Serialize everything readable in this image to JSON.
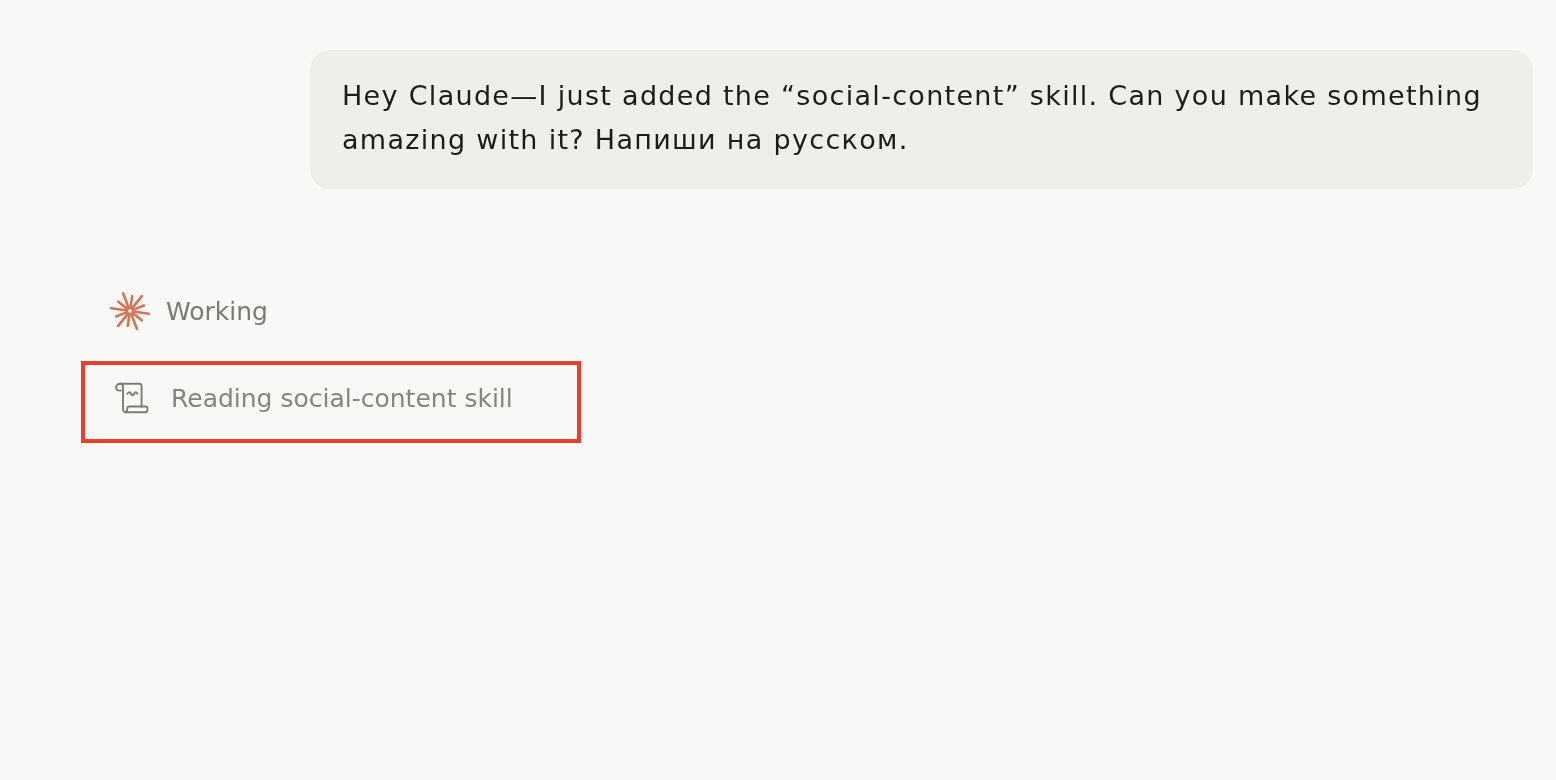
{
  "conversation": {
    "user_message": {
      "text": "Hey Claude—I just added the “social-content” skill. Can you make something amazing with it? Напиши на русском."
    }
  },
  "status": {
    "label": "Working"
  },
  "steps": [
    {
      "kind": "skill_read",
      "label": "Reading social-content skill",
      "highlighted": true
    }
  ]
}
